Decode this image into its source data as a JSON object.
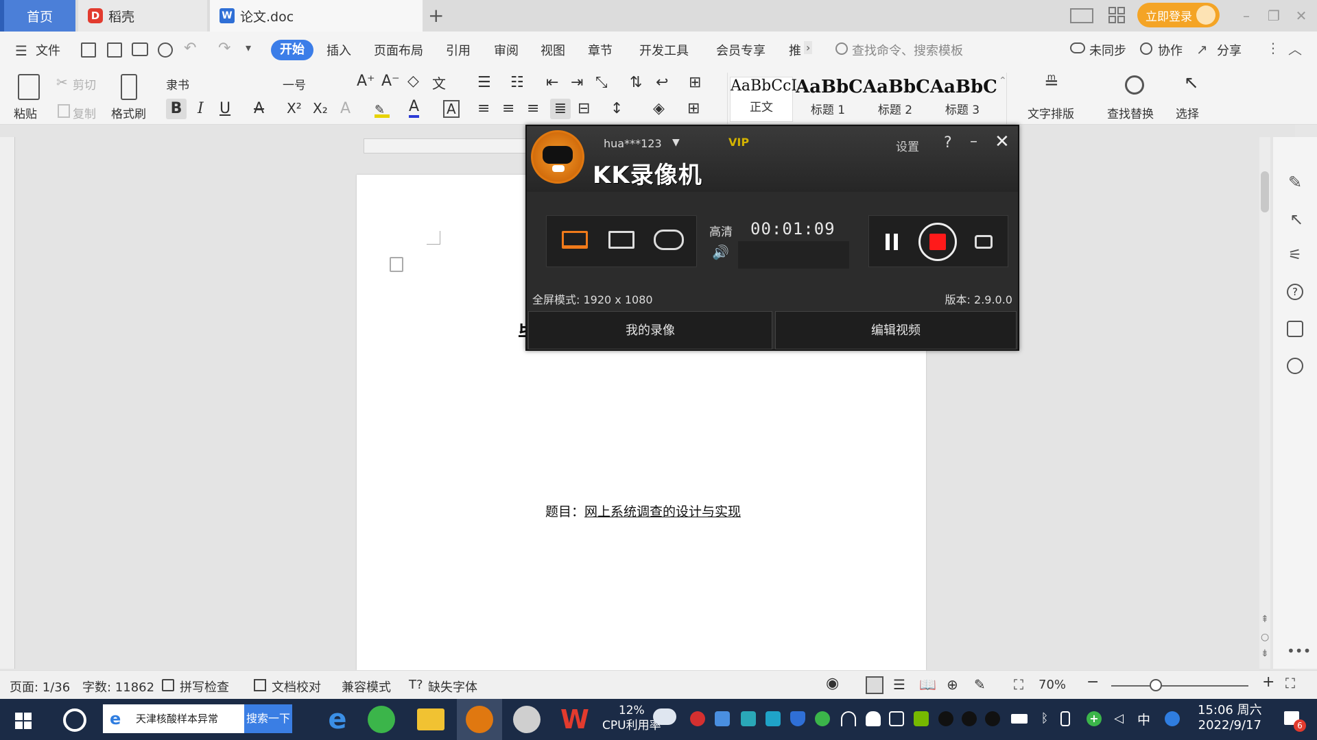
{
  "titlebar": {
    "tabs": [
      {
        "label": "首页"
      },
      {
        "label": "稻壳"
      },
      {
        "label": "论文.doc"
      }
    ],
    "new_tab": "+",
    "login": "立即登录"
  },
  "menu": {
    "file": "文件",
    "items": [
      "开始",
      "插入",
      "页面布局",
      "引用",
      "审阅",
      "视图",
      "章节",
      "开发工具",
      "会员专享",
      "推"
    ],
    "search_placeholder": "查找命令、搜索模板",
    "sync": "未同步",
    "collab": "协作",
    "share": "分享"
  },
  "ribbon": {
    "paste": "粘贴",
    "cut": "剪切",
    "copy": "复制",
    "format_painter": "格式刷",
    "font_name": "隶书",
    "font_size": "一号",
    "styles": [
      {
        "preview": "AaBbCcI",
        "label": "正文"
      },
      {
        "preview": "AaBbC",
        "label": "标题 1"
      },
      {
        "preview": "AaBbC",
        "label": "标题 2"
      },
      {
        "preview": "AaBbC",
        "label": "标题 3"
      }
    ],
    "text_layout": "文字排版",
    "find_replace": "查找替换",
    "select": "选择"
  },
  "document": {
    "title_prefix": "题目：",
    "title_text": "网上系统调查的设计与实现",
    "partial_heading": "毕"
  },
  "recorder": {
    "user": "hua***123",
    "vip": "VIP",
    "settings": "设置",
    "help": "?",
    "brand": "KK录像机",
    "quality": "高清",
    "time": "00:01:09",
    "mode": "全屏模式: 1920 x 1080",
    "version": "版本: 2.9.0.0",
    "my_recordings": "我的录像",
    "edit_video": "编辑视频",
    "record_color": "#ff1a1a"
  },
  "statusbar": {
    "page": "页面: 1/36",
    "words": "字数: 11862",
    "spell": "拼写检查",
    "proofread": "文档校对",
    "compat": "兼容模式",
    "missing_font": "缺失字体",
    "zoom": "70%"
  },
  "taskbar": {
    "search_text": "天津核酸样本异常",
    "search_button": "搜索一下",
    "cpu_percent": "12%",
    "cpu_label": "CPU利用率",
    "ime": "中",
    "time": "15:06 周六",
    "date": "2022/9/17",
    "notification_count": "6"
  },
  "colors": {
    "accent_blue": "#3b7de8",
    "login_orange": "#f4a425",
    "taskbar_bg": "#1b2b46"
  }
}
